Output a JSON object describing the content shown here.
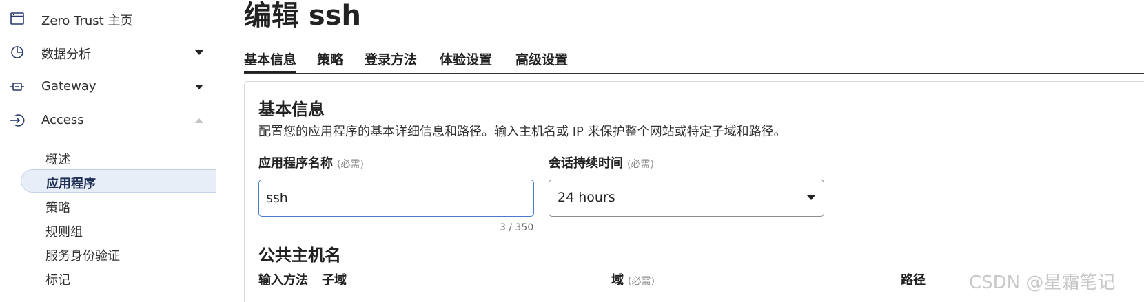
{
  "sidebar": {
    "items": [
      {
        "label": "Zero Trust 主页",
        "icon": "browser-window-icon"
      },
      {
        "label": "数据分析",
        "icon": "pie-chart-icon"
      },
      {
        "label": "Gateway",
        "icon": "gateway-icon"
      },
      {
        "label": "Access",
        "icon": "access-sign-in-icon"
      }
    ],
    "access_sub": [
      {
        "label": "概述"
      },
      {
        "label": "应用程序"
      },
      {
        "label": "策略"
      },
      {
        "label": "规则组"
      },
      {
        "label": "服务身份验证"
      },
      {
        "label": "标记"
      }
    ]
  },
  "page": {
    "title": "编辑 ssh"
  },
  "tabs": [
    {
      "label": "基本信息"
    },
    {
      "label": "策略"
    },
    {
      "label": "登录方法"
    },
    {
      "label": "体验设置"
    },
    {
      "label": "高级设置"
    }
  ],
  "basic_info": {
    "title": "基本信息",
    "description": "配置您的应用程序的基本详细信息和路径。输入主机名或 IP 来保护整个网站或特定子域和路径。",
    "app_name": {
      "label": "应用程序名称",
      "required": "(必需)",
      "value": "ssh",
      "counter": "3 / 350"
    },
    "session_duration": {
      "label": "会话持续时间",
      "required": "(必需)",
      "value": "24 hours"
    }
  },
  "public_hostname": {
    "title": "公共主机名",
    "input_method_label": "输入方法",
    "subdomain_label": "子域",
    "domain_label": "域",
    "domain_required": "(必需)",
    "path_label": "路径"
  },
  "watermark": "CSDN @星霜笔记",
  "colors": {
    "accent_border": "#4a7dd0",
    "active_bg": "#e8eef8"
  }
}
